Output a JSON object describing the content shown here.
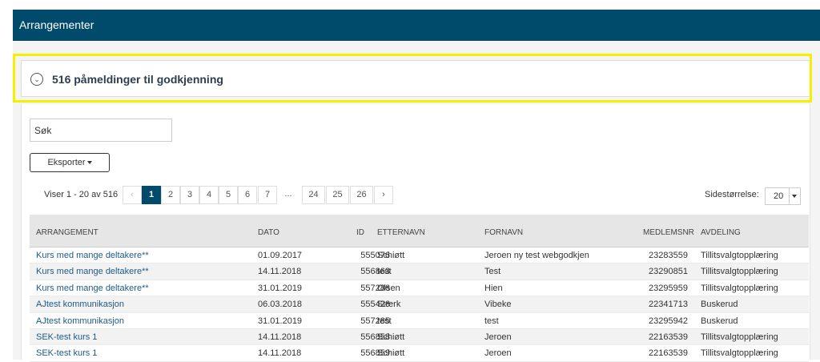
{
  "header": {
    "title": "Arrangementer"
  },
  "panel": {
    "icon": "chevron-down-circle-icon",
    "title": "516 påmeldinger til godkjenning"
  },
  "search": {
    "value": "Søk"
  },
  "toolbar": {
    "export_label": "Eksporter"
  },
  "pagination": {
    "showing": "Viser 1 - 20 av 516",
    "prev": "‹",
    "next": "›",
    "pages": [
      "1",
      "2",
      "3",
      "4",
      "5",
      "6",
      "7"
    ],
    "ellipsis": "...",
    "last_pages": [
      "24",
      "25",
      "26"
    ],
    "active_page": "1",
    "page_size_label": "Sidestørrelse:",
    "page_size": "20"
  },
  "table": {
    "columns": [
      "ARRANGEMENT",
      "DATO",
      "ID",
      "ETTERNAVN",
      "FORNAVN",
      "MEDLEMSNR",
      "AVDELING"
    ],
    "rows": [
      [
        "Kurs med mange deltakere**",
        "01.09.2017",
        "555076",
        "Schiøtt",
        "Jeroen ny test webgodkjen",
        "23283559",
        "Tillitsvalgtopplæring"
      ],
      [
        "Kurs med mange deltakere**",
        "14.11.2018",
        "556863",
        "test",
        "Test",
        "23290851",
        "Tillitsvalgtopplæring"
      ],
      [
        "Kurs med mange deltakere**",
        "31.01.2019",
        "557286",
        "Olsen",
        "Hien",
        "23295959",
        "Tillitsvalgtopplæring"
      ],
      [
        "AJtest kommunikasjon",
        "06.03.2018",
        "555426",
        "Stærk",
        "Vibeke",
        "22341713",
        "Buskerud"
      ],
      [
        "AJtest kommunikasjon",
        "31.01.2019",
        "557285",
        "test",
        "test",
        "23295942",
        "Buskerud"
      ],
      [
        "SEK-test kurs 1",
        "14.11.2018",
        "556858",
        "Schiøtt",
        "Jeroen",
        "22163539",
        "Tillitsvalgtopplæring"
      ],
      [
        "SEK-test kurs 1",
        "14.11.2018",
        "556859",
        "Schiøtt",
        "Jeroen",
        "22163539",
        "Tillitsvalgtopplæring"
      ]
    ]
  },
  "colors": {
    "brand": "#004a6b",
    "highlight": "#f6f000",
    "link": "#1e5b87"
  }
}
